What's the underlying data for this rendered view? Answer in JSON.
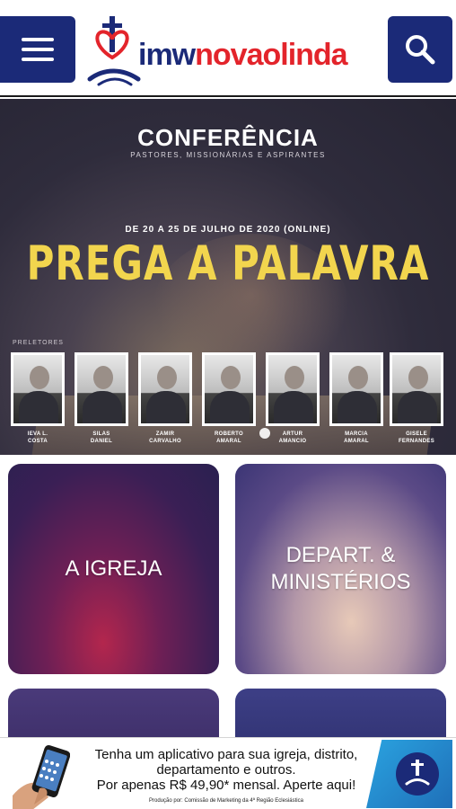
{
  "header": {
    "logo_imw": "imw",
    "logo_rest": "novaolinda",
    "menu_icon": "hamburger-menu-icon",
    "search_icon": "search-icon",
    "brand_blue": "#1b2a78",
    "brand_red": "#e3242b"
  },
  "banner": {
    "title": "CONFERÊNCIA",
    "subtitle": "PASTORES, MISSIONÁRIAS E ASPIRANTES",
    "dates": "DE 20 A 25 DE JULHO DE 2020 (ONLINE)",
    "headline": "PREGA A PALAVRA",
    "speakers_label": "PRELETORES",
    "speakers": [
      {
        "name": "IEVA L.\nCOSTA"
      },
      {
        "name": "SILAS\nDANIEL"
      },
      {
        "name": "ZAMIR\nCARVALHO"
      },
      {
        "name": "ROBERTO\nAMARAL"
      },
      {
        "name": "ARTUR\nAMANCIO"
      },
      {
        "name": "MARCIA\nAMARAL"
      },
      {
        "name": "GISELE\nFERNANDES"
      }
    ],
    "accent": "#f2d54e"
  },
  "tiles": [
    {
      "label": "A IGREJA"
    },
    {
      "label": "DEPART. &\nMINISTÉRIOS"
    }
  ],
  "ad": {
    "line1": "Tenha um aplicativo para sua igreja, distrito,",
    "line2": "departamento e outros.",
    "line3": "Por apenas R$ 49,90* mensal. Aperte aqui!",
    "credit": "Produção por: Comissão de Marketing da 4ª Região Eclesiástica"
  }
}
